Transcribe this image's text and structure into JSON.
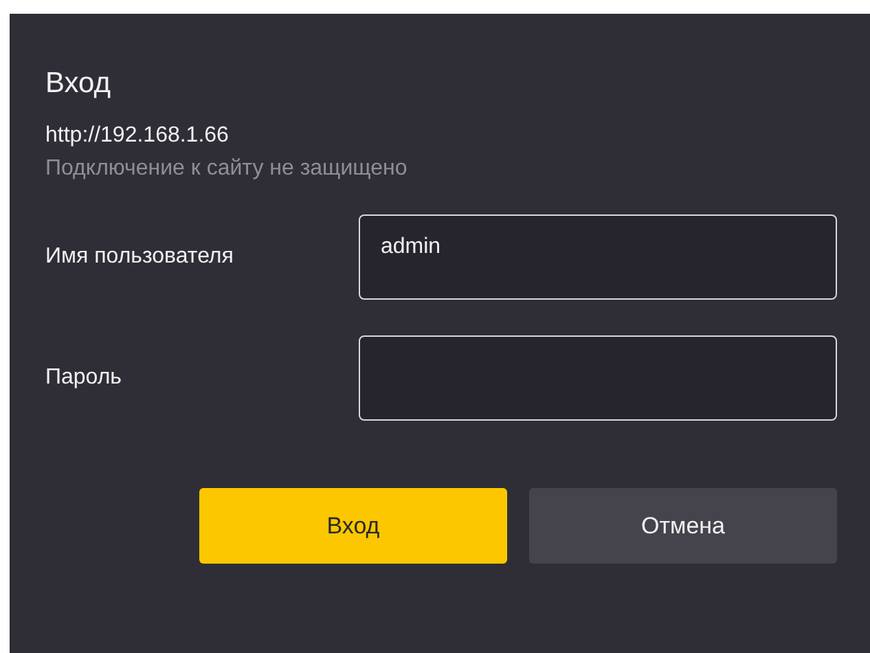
{
  "dialog": {
    "title": "Вход",
    "url": "http://192.168.1.66",
    "security_note": "Подключение к сайту не защищено"
  },
  "fields": [
    {
      "label": "Имя пользователя",
      "value": "admin"
    },
    {
      "label": "Пароль"
    }
  ],
  "buttons": [
    {
      "label": "Вход",
      "kind": "primary"
    },
    {
      "label": "Отмена",
      "kind": "secondary"
    }
  ]
}
